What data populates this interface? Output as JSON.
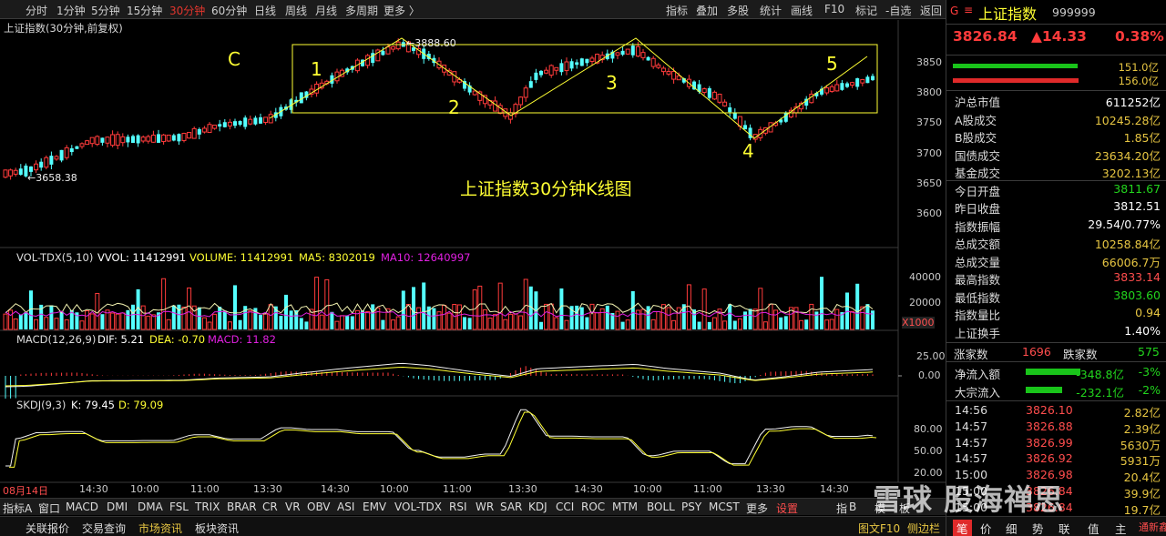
{
  "toolbar": {
    "periods": [
      "分时",
      "1分钟",
      "5分钟",
      "15分钟",
      "30分钟",
      "60分钟",
      "日线",
      "周线",
      "月线",
      "多周期",
      "更多 〉"
    ],
    "active_period": "30分钟",
    "tools": [
      "指标",
      "叠加",
      "多股",
      "统计",
      "画线",
      "F10",
      "标记",
      "-自选",
      "返回"
    ]
  },
  "chart_title": "上证指数(30分钟,前复权)",
  "annotation": "上证指数30分钟K线图",
  "wave_labels": [
    "C",
    "1",
    "2",
    "3",
    "4",
    "5"
  ],
  "price_marks": {
    "high": "3888.60",
    "low": "3658.38"
  },
  "price_axis": [
    "3850",
    "3800",
    "3750",
    "3700",
    "3650",
    "3600"
  ],
  "volume": {
    "label": "VOL-TDX(5,10)",
    "vvol": "VVOL: 11412991",
    "volume": "VOLUME: 11412991",
    "ma5": "MA5: 8302019",
    "ma10": "MA10: 12640997",
    "axis": [
      "40000",
      "20000"
    ],
    "unit": "X1000"
  },
  "macd": {
    "label": "MACD(12,26,9)",
    "dif": "DIF: 5.21",
    "dea": "DEA: -0.70",
    "macd": "MACD: 11.82",
    "axis": [
      "25.00",
      "0.00"
    ]
  },
  "skdj": {
    "label": "SKDJ(9,3)",
    "k": "K: 79.45",
    "d": "D: 79.09",
    "axis": [
      "80.00",
      "50.00",
      "20.00"
    ]
  },
  "time_axis": [
    "08月14日",
    "14:30",
    "10:00",
    "11:00",
    "13:30",
    "14:30",
    "10:00",
    "11:00",
    "13:30",
    "14:30",
    "10:00",
    "11:00",
    "13:30",
    "14:30"
  ],
  "indicator_tabs": [
    "指标A",
    "窗口",
    "MACD",
    "DMI",
    "DMA",
    "FSL",
    "TRIX",
    "BRAR",
    "CR",
    "VR",
    "OBV",
    "ASI",
    "EMV",
    "VOL-TDX",
    "RSI",
    "WR",
    "SAR",
    "KDJ",
    "CCI",
    "ROC",
    "MTM",
    "BOLL",
    "PSY",
    "MCST",
    "更多",
    "设置",
    "指",
    "B",
    "模",
    "板"
  ],
  "status_tabs": [
    "关联报价",
    "交易查询",
    "市场资讯",
    "板块资讯"
  ],
  "status_right": [
    "图文F10",
    "侧边栏"
  ],
  "watermark": "雪球 股海禅思",
  "quote": {
    "name": "上证指数",
    "code": "999999",
    "price": "3826.84",
    "change": "▲14.33",
    "pct": "0.38%",
    "bar1_value": "151.0亿",
    "bar2_value": "156.0亿",
    "bar1_ratio": 0.49,
    "bar2_ratio": 0.51
  },
  "stats": [
    {
      "k": "沪总市值",
      "v": "611252亿",
      "c": "white"
    },
    {
      "k": "A股成交",
      "v": "10245.28亿",
      "c": "gold"
    },
    {
      "k": "B股成交",
      "v": "1.85亿",
      "c": "gold"
    },
    {
      "k": "国债成交",
      "v": "23634.20亿",
      "c": "gold"
    },
    {
      "k": "基金成交",
      "v": "3202.13亿",
      "c": "gold"
    },
    {
      "k": "今日开盘",
      "v": "3811.67",
      "c": "green"
    },
    {
      "k": "昨日收盘",
      "v": "3812.51",
      "c": "white"
    },
    {
      "k": "指数振幅",
      "v": "29.54/0.77%",
      "c": "white"
    },
    {
      "k": "总成交额",
      "v": "10258.84亿",
      "c": "gold"
    },
    {
      "k": "总成交量",
      "v": "66006.7万",
      "c": "gold"
    },
    {
      "k": "最高指数",
      "v": "3833.14",
      "c": "red"
    },
    {
      "k": "最低指数",
      "v": "3803.60",
      "c": "green"
    },
    {
      "k": "指数量比",
      "v": "0.94",
      "c": "gold"
    },
    {
      "k": "上证换手",
      "v": "1.40%",
      "c": "white"
    }
  ],
  "breadth": {
    "up_label": "涨家数",
    "up": "1696",
    "down_label": "跌家数",
    "down": "575"
  },
  "flows": [
    {
      "k": "净流入额",
      "v": "-348.8亿",
      "p": "-3%",
      "ratio": 0.6
    },
    {
      "k": "大宗流入",
      "v": "-232.1亿",
      "p": "-2%",
      "ratio": 0.4
    }
  ],
  "ticks": [
    {
      "t": "14:56",
      "p": "3826.10",
      "v": "2.82亿"
    },
    {
      "t": "14:57",
      "p": "3826.88",
      "v": "2.39亿"
    },
    {
      "t": "14:57",
      "p": "3826.99",
      "v": "5630万"
    },
    {
      "t": "14:57",
      "p": "3826.92",
      "v": "5931万"
    },
    {
      "t": "15:00",
      "p": "3826.98",
      "v": "20.4亿"
    },
    {
      "t": "15:00",
      "p": "3826.84",
      "v": "39.9亿"
    },
    {
      "t": "15:00",
      "p": "3826.84",
      "v": "19.7亿"
    }
  ],
  "side_tabs": [
    "笔",
    "价",
    "细",
    "势",
    "联",
    "值",
    "主",
    "通新鑫"
  ]
}
